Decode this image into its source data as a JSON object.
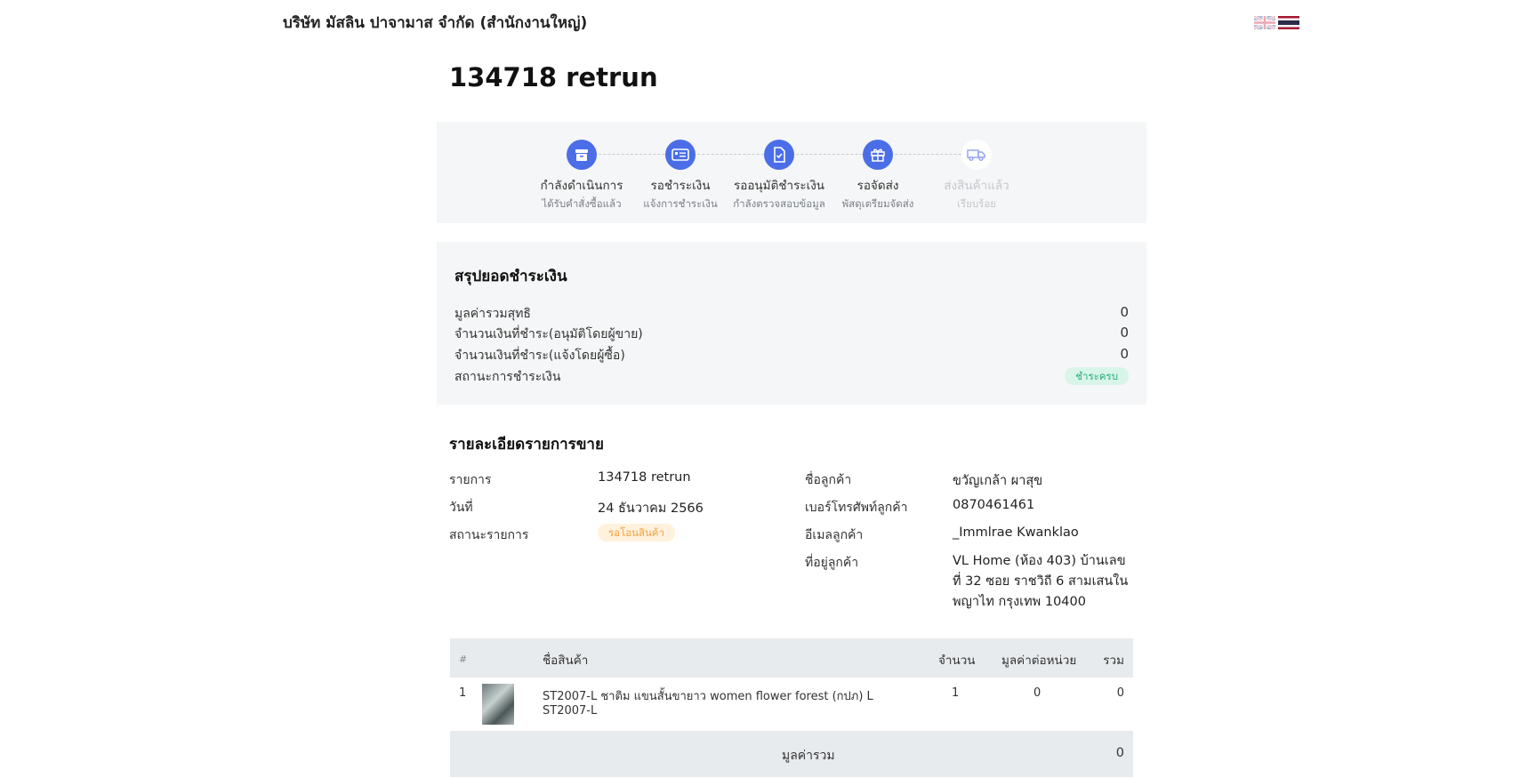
{
  "company_name": "บริษัท มัสลิน ปาจามาส จำกัด (สำนักงานใหญ่)",
  "languages": [
    "en",
    "th"
  ],
  "title": "134718 retrun",
  "steps": [
    {
      "label": "กำลังดำเนินการ",
      "sub": "ได้รับคำสั่งซื้อแล้ว",
      "icon": "box-icon",
      "active": true
    },
    {
      "label": "รอชำระเงิน",
      "sub": "แจ้งการชำระเงิน",
      "icon": "payment-card-icon",
      "active": true
    },
    {
      "label": "รออนุมัติชำระเงิน",
      "sub": "กำลังตรวจสอบข้อมูล",
      "icon": "document-check-icon",
      "active": true
    },
    {
      "label": "รอจัดส่ง",
      "sub": "พัสดุเตรียมจัดส่ง",
      "icon": "gift-box-icon",
      "active": true
    },
    {
      "label": "ส่งสินค้าแล้ว",
      "sub": "เรียบร้อย",
      "icon": "truck-icon",
      "active": false
    }
  ],
  "summary": {
    "title": "สรุปยอดชำระเงิน",
    "rows": [
      {
        "label": "มูลค่ารวมสุทธิ",
        "value": "0"
      },
      {
        "label": "จำนวนเงินที่ชำระ(อนุมัติโดยผู้ขาย)",
        "value": "0"
      },
      {
        "label": "จำนวนเงินที่ชำระ(แจ้งโดยผู้ซื้อ)",
        "value": "0"
      }
    ],
    "status_label": "สถานะการชำระเงิน",
    "status_badge": "ชำระครบ"
  },
  "details": {
    "title": "รายละเอียดรายการขาย",
    "order_label": "รายการ",
    "order_value": "134718 retrun",
    "date_label": "วันที่",
    "date_value": "24 ธันวาคม 2566",
    "status_label": "สถานะรายการ",
    "status_badge": "รอโอนสินค้า",
    "customer_name_label": "ชื่อลูกค้า",
    "customer_name_value": "ขวัญเกล้า ผาสุข",
    "phone_label": "เบอร์โทรศัพท์ลูกค้า",
    "phone_value": "0870461461",
    "email_label": "อีเมลลูกค้า",
    "email_value": "_Immlrae Kwanklao",
    "address_label": "ที่อยู่ลูกค้า",
    "address_value": "VL Home (ห้อง 403) บ้านเลขที่ 32 ซอย ราชวิถี 6 สามเสนใน พญาไท กรุงเทพ 10400"
  },
  "table": {
    "headers": {
      "index": "#",
      "name": "ชื่อสินค้า",
      "qty": "จำนวน",
      "unit_price": "มูลค่าต่อหน่วย",
      "total": "รวม"
    },
    "rows": [
      {
        "index": "1",
        "name_line1": "ST2007-L ชาติม แขนสั้นขายาว women flower forest (กปภ) L",
        "name_line2": "ST2007-L",
        "qty": "1",
        "unit_price": "0",
        "total": "0"
      }
    ],
    "footer_label": "มูลค่ารวม",
    "footer_value": "0"
  },
  "colors": {
    "accent": "#4b6ee8",
    "success": "#2bab7a",
    "warning": "#f0a23e"
  }
}
